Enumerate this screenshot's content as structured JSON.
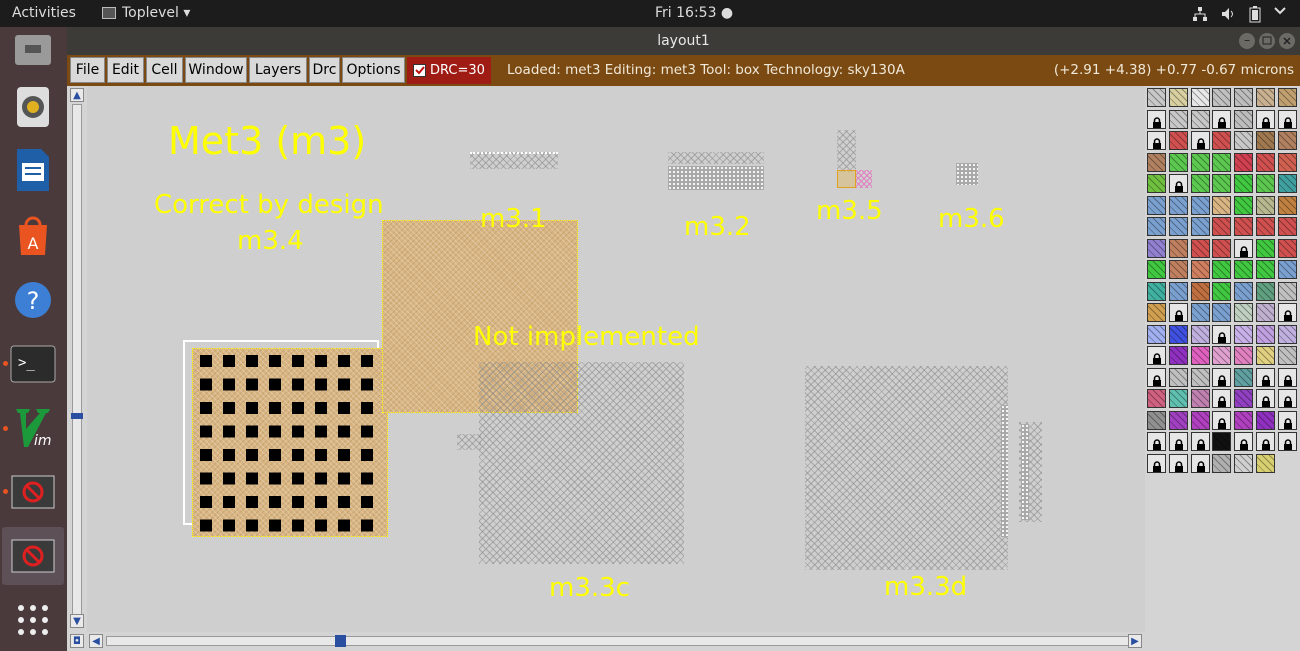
{
  "topbar": {
    "activities": "Activities",
    "app_menu": "Toplevel ▾",
    "clock": "Fri 16:53 ●"
  },
  "window": {
    "title": "layout1"
  },
  "menu": {
    "items": [
      "File",
      "Edit",
      "Cell",
      "Window",
      "Layers",
      "Drc",
      "Options"
    ],
    "drc_label": "DRC=30",
    "drc_checked": true,
    "status": "Loaded: met3 Editing: met3 Tool: box  Technology: sky130A",
    "coords": "(+2.91 +4.38) +0.77 -0.67 microns"
  },
  "canvas": {
    "labels": {
      "title": "Met3 (m3)",
      "correct": "Correct by design",
      "m34": "m3.4",
      "m31": "m3.1",
      "m32": "m3.2",
      "m35": "m3.5",
      "m36": "m3.6",
      "not_impl": "Not implemented",
      "m33c": "m3.3c",
      "m33d": "m3.3d"
    }
  },
  "colors": {
    "label": "#ffff00",
    "canvas_bg": "#cfcfcf",
    "menubar": "#7a4a12",
    "drc": "#9e1c14",
    "metal3_tan": "#d8b582"
  },
  "dock": {
    "icons": [
      "file-manager-icon",
      "speaker-icon",
      "writer-icon",
      "software-center-icon",
      "help-icon",
      "terminal-icon",
      "vim-icon",
      "app-window-icon",
      "app-window-icon-2",
      "show-apps-icon"
    ]
  },
  "palette": {
    "rows": [
      [
        "#c8c8c8",
        "#d8d0a0",
        "#e8e8e8",
        "#c0c0c0",
        "#bdbdbd",
        "#c8b090",
        "#c0a070"
      ],
      [
        "lock",
        "#c8c8c8",
        "#c8c8c8",
        "lock",
        "#bdbdbd",
        "lock",
        "lock"
      ],
      [
        "lock",
        "#d05050",
        "lock",
        "#d05050",
        "#c8c8c8",
        "#a07850",
        "#b08060"
      ],
      [
        "#b08060",
        "#5cc850",
        "#5cc850",
        "#5cc850",
        "#d04050",
        "#d05050",
        "#d06050"
      ],
      [
        "#70c040",
        "lock",
        "#5cc850",
        "#5cc850",
        "#40c840",
        "#5cc850",
        "#40a0a0"
      ],
      [
        "#7aa0d0",
        "#7aa0d0",
        "#7aa0d0",
        "#d8b582",
        "#40c840",
        "#b8b890",
        "#c08040"
      ],
      [
        "#7aa0d0",
        "#7aa0d0",
        "#7aa0d0",
        "#d05050",
        "#d05050",
        "#d05050",
        "#d05050"
      ],
      [
        "#9080d0",
        "#c08060",
        "#d05050",
        "#d05050",
        "lock",
        "#40c840",
        "#d05050"
      ],
      [
        "#40c840",
        "#c08060",
        "#d08060",
        "#40c840",
        "#40c840",
        "#40c840",
        "#7aa0d0"
      ],
      [
        "#40b0a0",
        "#7aa0d0",
        "#c07040",
        "#40c840",
        "#7aa0d0",
        "#60a080",
        "#c0c0c0"
      ],
      [
        "#d0a050",
        "lock",
        "#7aa0d0",
        "#7aa0d0",
        "#c0d0c0",
        "#c0b0d0",
        "lock"
      ],
      [
        "#a0b0f0",
        "#4050e0",
        "#c0b0e0",
        "lock",
        "#c8b0e8",
        "#c0a0e0",
        "#c0b0e0"
      ],
      [
        "lock",
        "#9030c0",
        "#e060c0",
        "#e0a0d0",
        "#e080c0",
        "#e0d080",
        "#c0c0c0"
      ],
      [
        "lock",
        "#c0c0c0",
        "#c0c0c0",
        "lock",
        "#60a0a0",
        "lock",
        "lock"
      ],
      [
        "#d06080",
        "#60c0b0",
        "#c080b0",
        "lock",
        "#9040c0",
        "lock",
        "lock"
      ],
      [
        "#909090",
        "#a040c0",
        "#b040c0",
        "lock",
        "#b040c0",
        "#9030c0",
        "lock"
      ],
      [
        "lock",
        "lock",
        "lock",
        "#101010",
        "lock",
        "lock",
        "lock"
      ],
      [
        "lock",
        "lock",
        "lock",
        "#b0b0b0",
        "#d0d0d0",
        "#d8d070"
      ]
    ]
  }
}
